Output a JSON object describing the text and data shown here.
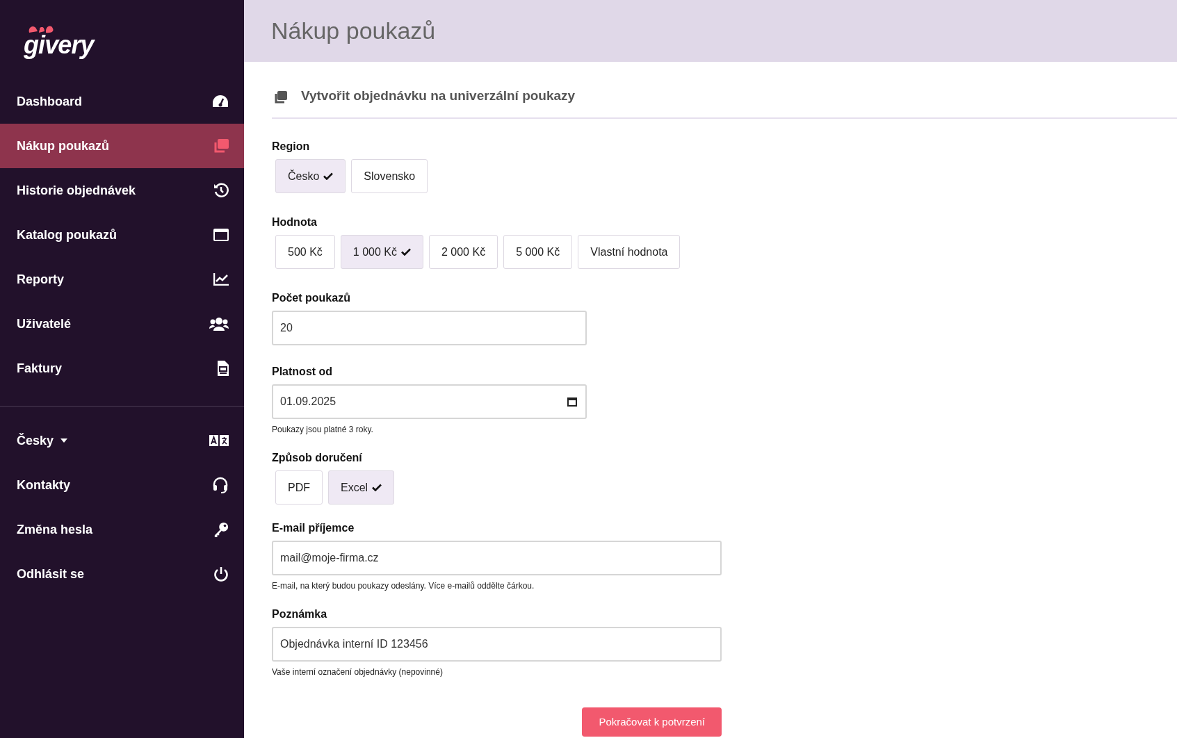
{
  "logo": {
    "text": "givery"
  },
  "nav": [
    {
      "label": "Dashboard",
      "selected": false
    },
    {
      "label": "Nákup poukazů",
      "selected": true
    },
    {
      "label": "Historie objednávek",
      "selected": false
    },
    {
      "label": "Katalog poukazů",
      "selected": false
    },
    {
      "label": "Reporty",
      "selected": false
    },
    {
      "label": "Uživatelé",
      "selected": false
    },
    {
      "label": "Faktury",
      "selected": false
    }
  ],
  "nav_secondary": [
    {
      "label": "Česky",
      "kind": "dropdown"
    },
    {
      "label": "Kontakty",
      "kind": "link"
    },
    {
      "label": "Změna hesla",
      "kind": "link"
    },
    {
      "label": "Odhlásit se",
      "kind": "link"
    }
  ],
  "header": {
    "title": "Nákup poukazů"
  },
  "card": {
    "title": "Vytvořit objednávku na univerzální poukazy"
  },
  "form": [
    {
      "kind": "choice",
      "label": "Region",
      "options": [
        {
          "label": "Česko",
          "selected": true
        },
        {
          "label": "Slovensko",
          "selected": false
        }
      ]
    },
    {
      "kind": "choice",
      "label": "Hodnota",
      "options": [
        {
          "label": "500 Kč",
          "selected": false
        },
        {
          "label": "1 000 Kč",
          "selected": true
        },
        {
          "label": "2 000 Kč",
          "selected": false
        },
        {
          "label": "5 000 Kč",
          "selected": false
        },
        {
          "label": "Vlastní hodnota",
          "selected": false
        }
      ]
    },
    {
      "kind": "short_input",
      "label": "Počet poukazů",
      "value": "20"
    },
    {
      "kind": "date",
      "label": "Platnost od",
      "value": "01.09.2025",
      "hint": "Poukazy jsou platné 3 roky."
    },
    {
      "kind": "choice",
      "label": "Způsob doručení",
      "options": [
        {
          "label": "PDF",
          "selected": false
        },
        {
          "label": "Excel",
          "selected": true
        }
      ]
    },
    {
      "kind": "input",
      "label": "E-mail příjemce",
      "value": "mail@moje-firma.cz",
      "hint": "E-mail, na který budou poukazy odeslány. Více e-mailů oddělte čárkou."
    },
    {
      "kind": "input",
      "label": "Poznámka",
      "value": "Objednávka interní ID 123456",
      "hint": "Vaše interní označení objednávky (nepovinné)"
    }
  ],
  "submit": {
    "label": "Pokračovat k potvrzení"
  }
}
